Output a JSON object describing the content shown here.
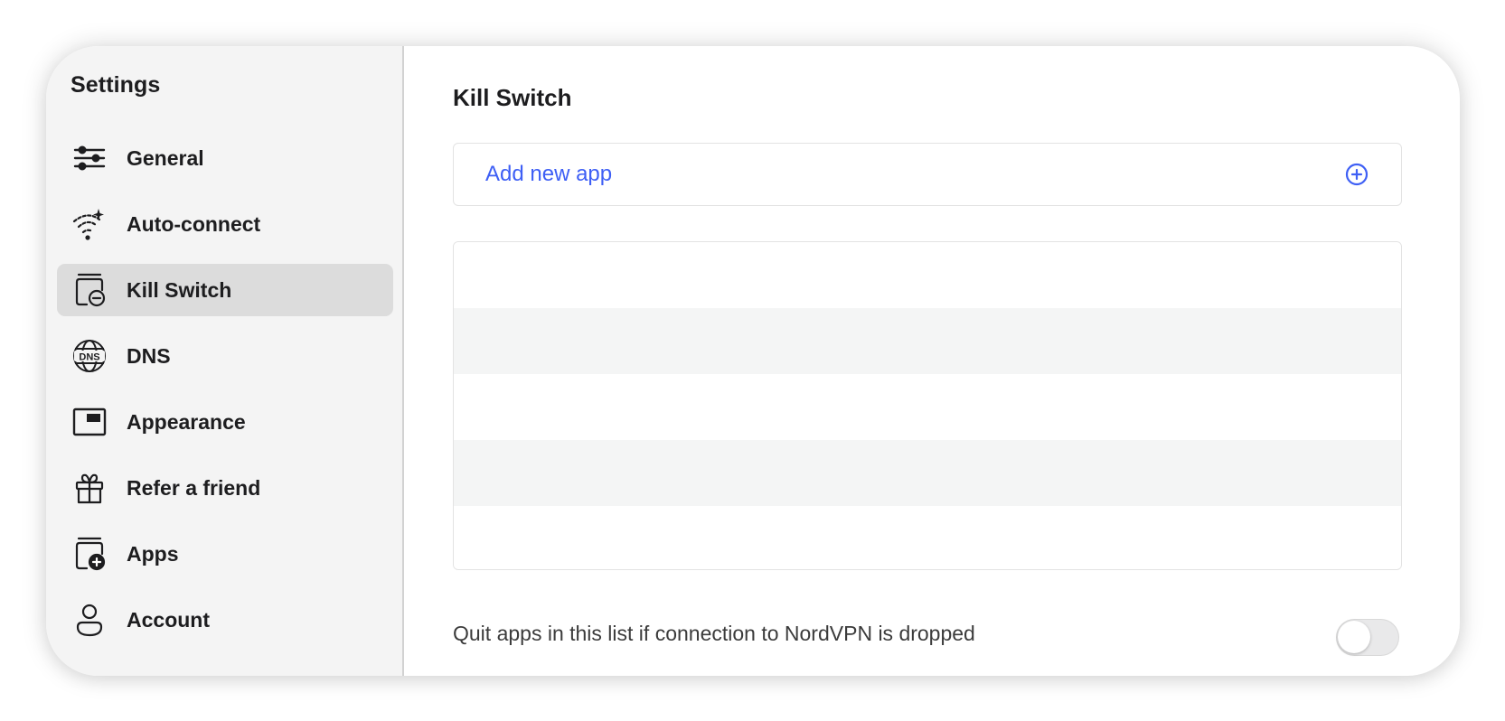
{
  "sidebar": {
    "title": "Settings",
    "items": [
      {
        "label": "General",
        "icon": "sliders-icon",
        "active": false
      },
      {
        "label": "Auto-connect",
        "icon": "wifi-sparkle-icon",
        "active": false
      },
      {
        "label": "Kill Switch",
        "icon": "kill-switch-icon",
        "active": true
      },
      {
        "label": "DNS",
        "icon": "dns-globe-icon",
        "active": false
      },
      {
        "label": "Appearance",
        "icon": "appearance-window-icon",
        "active": false
      },
      {
        "label": "Refer a friend",
        "icon": "gift-icon",
        "active": false
      },
      {
        "label": "Apps",
        "icon": "apps-plus-icon",
        "active": false
      },
      {
        "label": "Account",
        "icon": "person-icon",
        "active": false
      }
    ]
  },
  "main": {
    "title": "Kill Switch",
    "add_app": {
      "label": "Add new app",
      "icon": "plus-circle-icon"
    },
    "app_list": {
      "rows": 5
    },
    "quit_setting": {
      "label": "Quit apps in this list if connection to NordVPN is dropped",
      "enabled": false
    }
  },
  "colors": {
    "accent": "#3e5ff5",
    "sidebar_bg": "#f4f4f4",
    "active_item_bg": "#dcdcdc"
  }
}
